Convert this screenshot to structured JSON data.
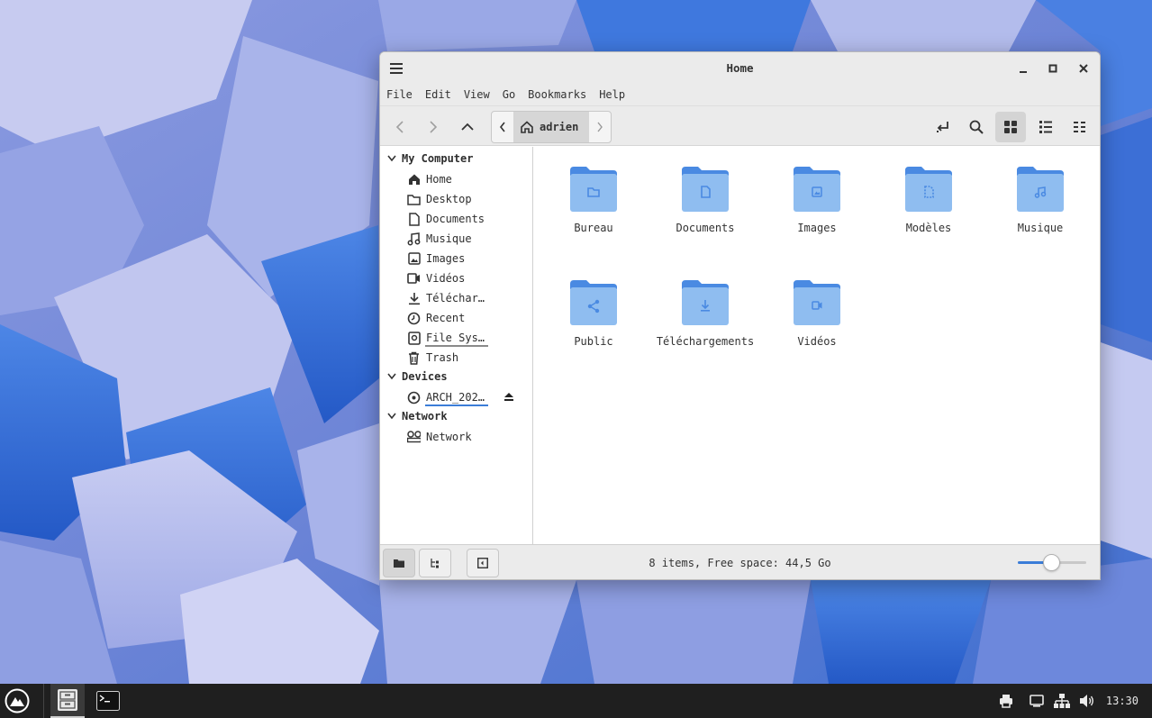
{
  "window": {
    "title": "Home",
    "menu": [
      "File",
      "Edit",
      "View",
      "Go",
      "Bookmarks",
      "Help"
    ],
    "path_crumb": "adrien"
  },
  "sidebar": {
    "sections": [
      {
        "label": "My Computer",
        "items": [
          {
            "label": "Home",
            "icon": "home-icon"
          },
          {
            "label": "Desktop",
            "icon": "folder-icon"
          },
          {
            "label": "Documents",
            "icon": "document-icon"
          },
          {
            "label": "Musique",
            "icon": "music-icon"
          },
          {
            "label": "Images",
            "icon": "image-icon"
          },
          {
            "label": "Vidéos",
            "icon": "video-icon"
          },
          {
            "label": "Télécharg…",
            "icon": "download-icon"
          },
          {
            "label": "Recent",
            "icon": "clock-icon"
          },
          {
            "label": "File Syst…",
            "icon": "drive-icon"
          },
          {
            "label": "Trash",
            "icon": "trash-icon"
          }
        ]
      },
      {
        "label": "Devices",
        "items": [
          {
            "label": "ARCH_2025…",
            "icon": "disc-icon"
          }
        ]
      },
      {
        "label": "Network",
        "items": [
          {
            "label": "Network",
            "icon": "network-icon"
          }
        ]
      }
    ]
  },
  "files": [
    {
      "name": "Bureau",
      "icon": "folder-icon"
    },
    {
      "name": "Documents",
      "icon": "document-icon"
    },
    {
      "name": "Images",
      "icon": "image-icon"
    },
    {
      "name": "Modèles",
      "icon": "template-icon"
    },
    {
      "name": "Musique",
      "icon": "music-icon"
    },
    {
      "name": "Public",
      "icon": "share-icon"
    },
    {
      "name": "Téléchargements",
      "icon": "download-icon"
    },
    {
      "name": "Vidéos",
      "icon": "video-icon"
    }
  ],
  "status": {
    "text": "8 items, Free space: 44,5 Go",
    "zoom_fraction": 0.5
  },
  "taskbar": {
    "clock": "13:30"
  },
  "colors": {
    "accent": "#3b7dd8",
    "folder": "#5b9be6",
    "folder_light": "#8fbdf0"
  }
}
